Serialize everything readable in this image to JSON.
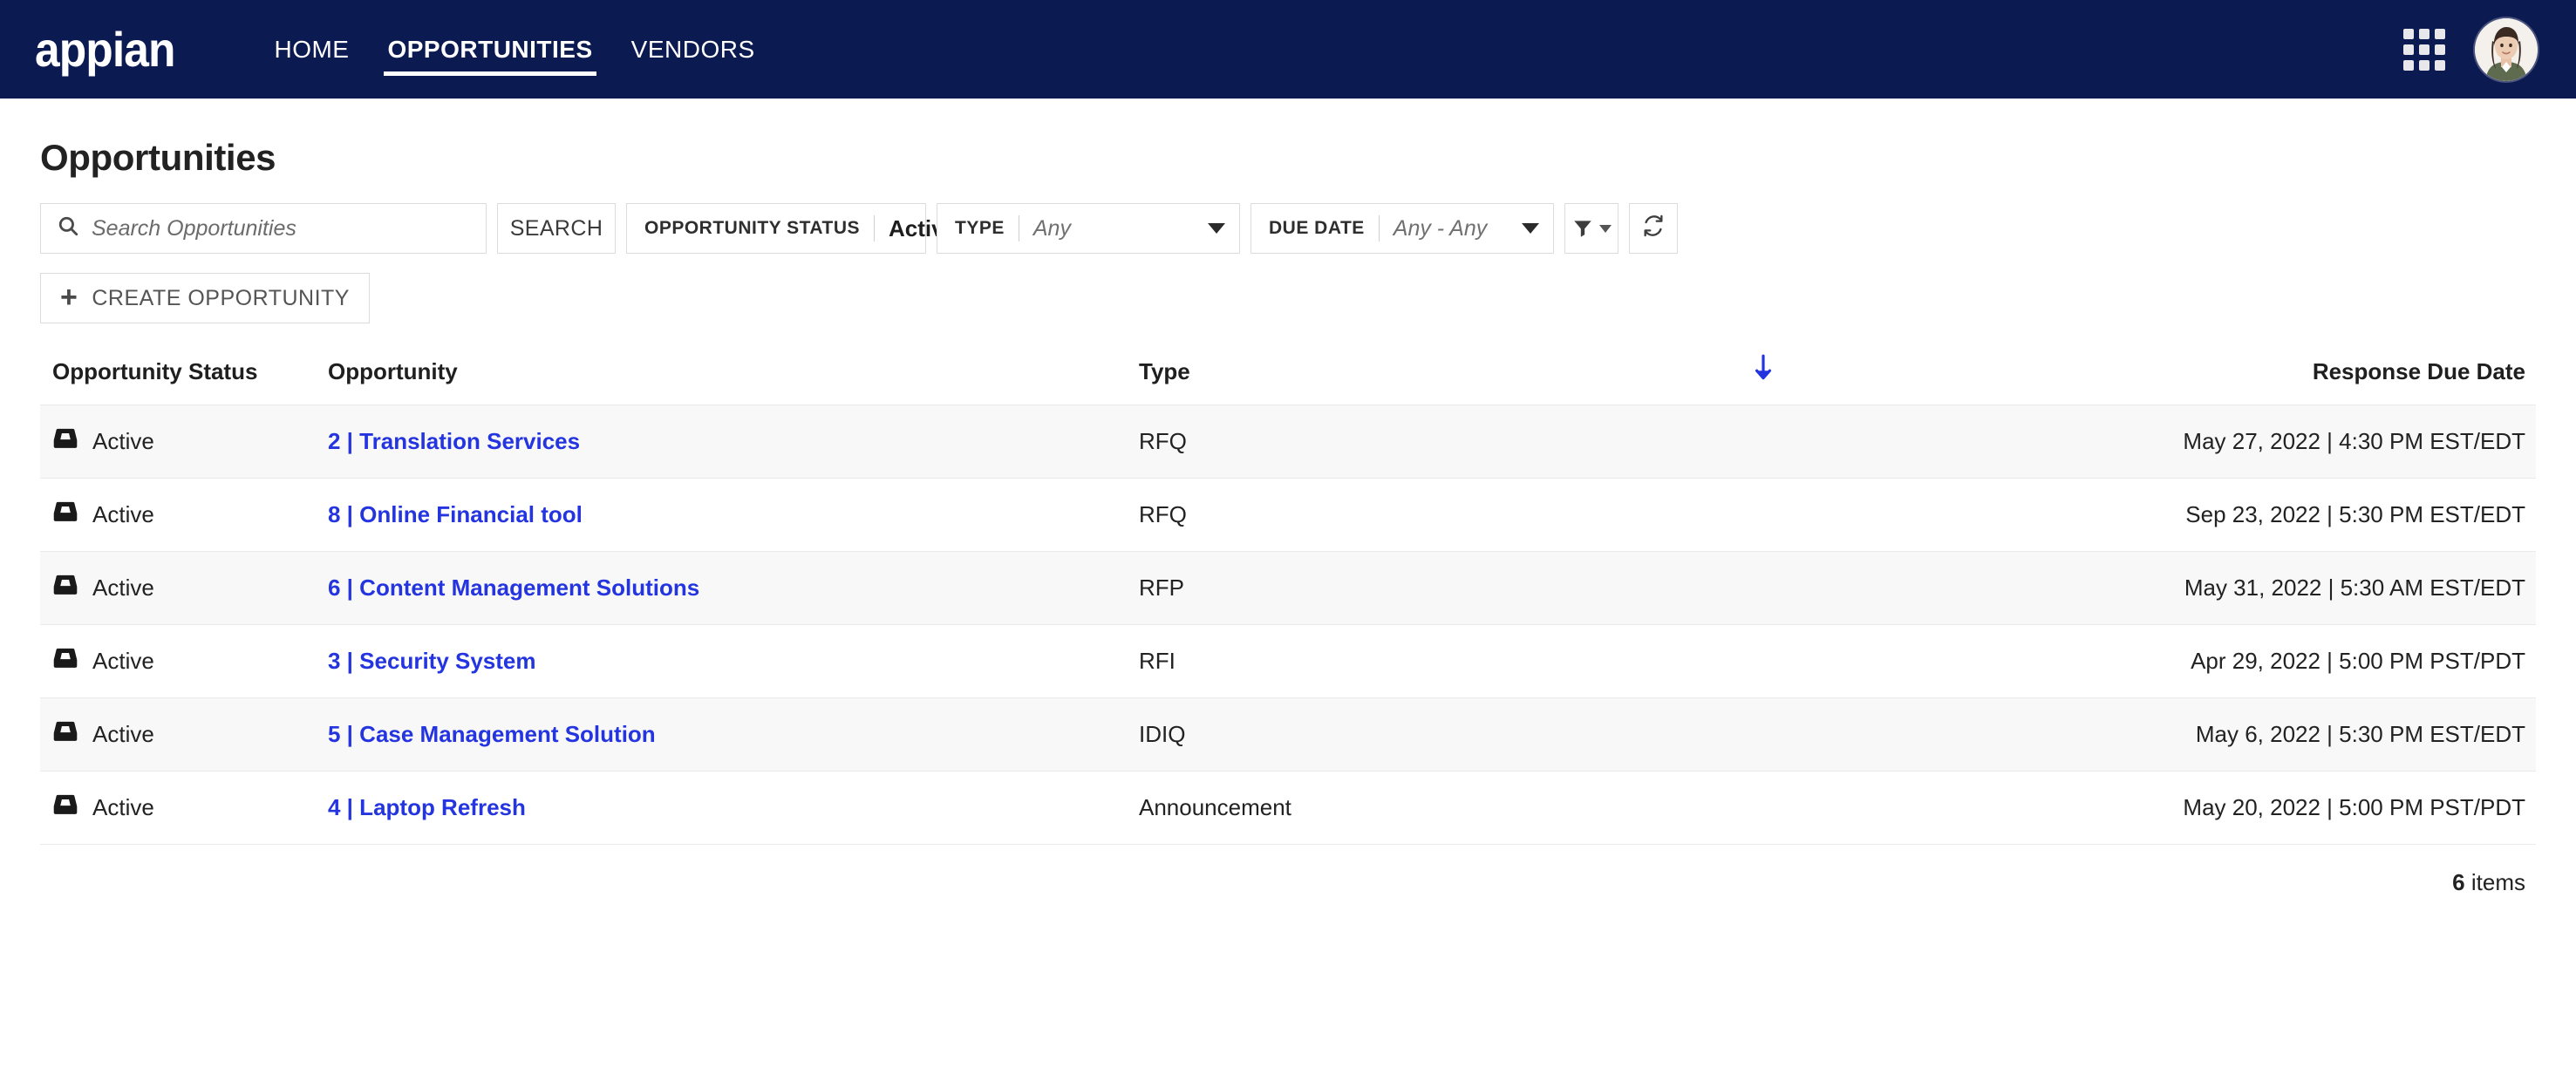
{
  "nav": {
    "brand": "appian",
    "links": [
      {
        "label": "HOME",
        "active": false
      },
      {
        "label": "OPPORTUNITIES",
        "active": true
      },
      {
        "label": "VENDORS",
        "active": false
      }
    ],
    "apps_icon": "grid-apps-icon",
    "avatar_icon": "user-avatar"
  },
  "page": {
    "title": "Opportunities"
  },
  "search": {
    "icon": "search-icon",
    "placeholder": "Search Opportunities",
    "value": "",
    "button_label": "SEARCH"
  },
  "filters": {
    "status": {
      "label": "OPPORTUNITY STATUS",
      "value": "Active",
      "clear_icon": "clear-circle-icon",
      "caret_icon": "chevron-down-icon"
    },
    "type": {
      "label": "TYPE",
      "value": "Any",
      "is_placeholder": true,
      "caret_icon": "chevron-down-icon"
    },
    "due_date": {
      "label": "DUE DATE",
      "value": "Any - Any",
      "is_placeholder": true,
      "caret_icon": "chevron-down-icon"
    },
    "filter_button_icon": "funnel-icon",
    "refresh_button_icon": "refresh-icon"
  },
  "actions": {
    "create_label": "CREATE OPPORTUNITY",
    "create_icon": "plus-icon"
  },
  "table": {
    "columns": [
      {
        "key": "status",
        "label": "Opportunity Status",
        "align": "left"
      },
      {
        "key": "opportunity",
        "label": "Opportunity",
        "align": "left"
      },
      {
        "key": "type",
        "label": "Type",
        "align": "left"
      },
      {
        "key": "due",
        "label": "Response Due Date",
        "align": "right"
      }
    ],
    "sort": {
      "column": "type",
      "direction": "desc",
      "icon": "arrow-down-icon",
      "color": "#2435e0"
    },
    "rows": [
      {
        "status": "Active",
        "status_icon": "inbox-icon",
        "opportunity": "2 | Translation Services",
        "type": "RFQ",
        "due": "May 27, 2022 | 4:30 PM EST/EDT"
      },
      {
        "status": "Active",
        "status_icon": "inbox-icon",
        "opportunity": "8 | Online Financial tool",
        "type": "RFQ",
        "due": "Sep 23, 2022 | 5:30 PM EST/EDT"
      },
      {
        "status": "Active",
        "status_icon": "inbox-icon",
        "opportunity": "6 | Content Management Solutions",
        "type": "RFP",
        "due": "May 31, 2022 | 5:30 AM EST/EDT"
      },
      {
        "status": "Active",
        "status_icon": "inbox-icon",
        "opportunity": "3 | Security System",
        "type": "RFI",
        "due": "Apr 29, 2022 | 5:00 PM PST/PDT"
      },
      {
        "status": "Active",
        "status_icon": "inbox-icon",
        "opportunity": "5 | Case Management Solution",
        "type": "IDIQ",
        "due": "May 6, 2022 | 5:30 PM EST/EDT"
      },
      {
        "status": "Active",
        "status_icon": "inbox-icon",
        "opportunity": "4 | Laptop Refresh",
        "type": "Announcement",
        "due": "May 20, 2022 | 5:00 PM PST/PDT"
      }
    ],
    "footer_count": "6",
    "footer_label": "items"
  },
  "colors": {
    "nav_background": "#0c1a52",
    "link_blue": "#2435e0",
    "row_alt": "#f8f8f8",
    "border": "#eaeaea"
  }
}
